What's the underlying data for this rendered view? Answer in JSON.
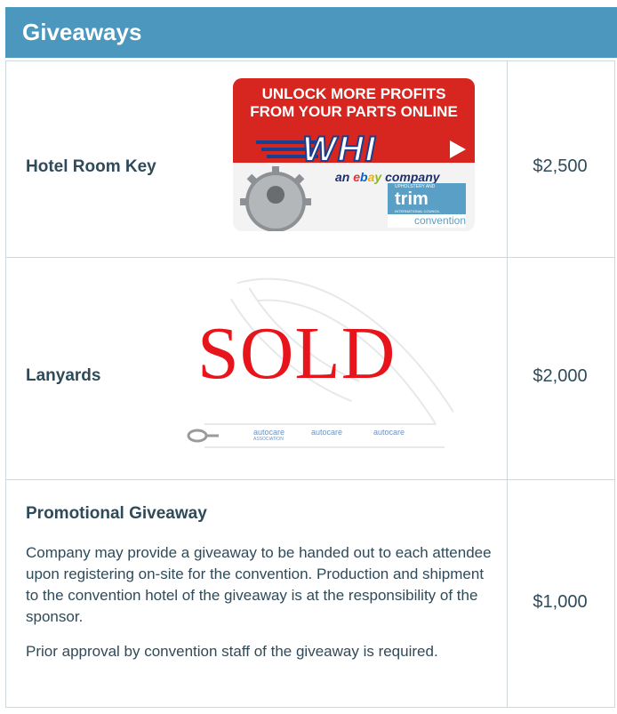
{
  "header": {
    "title": "Giveaways"
  },
  "rows": [
    {
      "title": "Hotel Room Key",
      "price": "$2,500"
    },
    {
      "title": "Lanyards",
      "price": "$2,000",
      "overlay": "SOLD"
    },
    {
      "title": "Promotional Giveaway",
      "price": "$1,000",
      "paragraphs": [
        "Company may provide a giveaway to be handed out to each attendee upon registering on-site for the convention. Production and shipment to the convention hotel of the giveaway is at the responsibility of the sponsor.",
        "Prior approval by convention staff of the giveaway is required."
      ]
    }
  ],
  "keycard": {
    "headline_1": "UNLOCK MORE PROFITS",
    "headline_2": "FROM YOUR PARTS ONLINE",
    "logo": "WHI",
    "ebay_prefix": "an ",
    "ebay_e": "e",
    "ebay_b": "b",
    "ebay_a": "a",
    "ebay_y": "y",
    "ebay_suffix": " company",
    "trim_top": "UPHOLSTERY AND",
    "trim_word": "trim",
    "trim_sub": "INTERNATIONAL COUNCIL",
    "trim_bottom": "convention"
  },
  "lanyard": {
    "brand": "autocare",
    "brand_sub": "ASSOCIATION"
  },
  "colors": {
    "header_bg": "#4b97bd",
    "text": "#2f4a59",
    "sold_red": "#e8141b",
    "card_red": "#d7261f",
    "rule": "#cfd8dc"
  }
}
